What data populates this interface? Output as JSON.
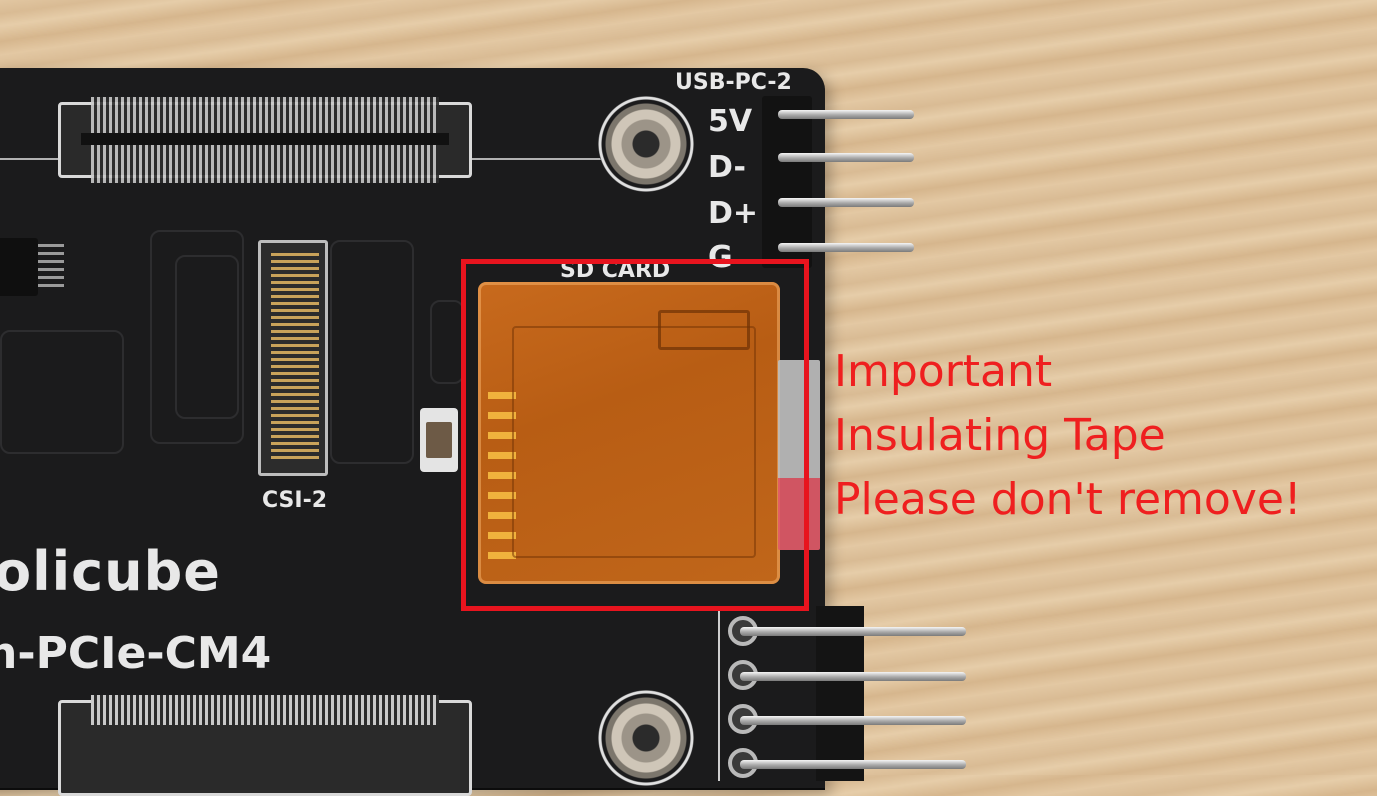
{
  "silkscreen": {
    "usb_header": "USB-PC-2",
    "pins": [
      "5V",
      "D-",
      "D+",
      "G"
    ],
    "sd_slot": "SD CARD",
    "camera_connector": "CSI-2",
    "brand": "olicube",
    "model": "n-PCIe-CM4"
  },
  "annotation": {
    "line1": "Important",
    "line2": "Insulating Tape",
    "line3": "Please don't remove!"
  },
  "colors": {
    "pcb": "#1b1b1c",
    "silkscreen": "#e8e8e8",
    "highlight": "#e8141e",
    "annotation_text": "#ef1f1f",
    "kapton_tape": "#c0661a",
    "wood": "#e2c7a2"
  }
}
